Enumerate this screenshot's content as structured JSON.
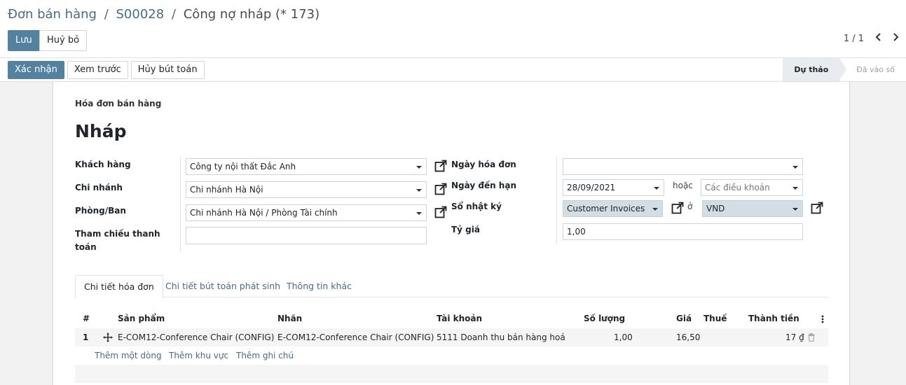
{
  "breadcrumb": {
    "parent": "Đơn bán hàng",
    "sep1": "/",
    "order": "S00028",
    "sep2": "/",
    "current": "Công nợ nháp (* 173)"
  },
  "actions": {
    "save": "Lưu",
    "discard": "Huỷ bỏ"
  },
  "pager": {
    "value": "1 / 1"
  },
  "statusbar": {
    "buttons": [
      "Xác nhận",
      "Xem trước",
      "Hủy bút toán"
    ],
    "stages": [
      {
        "label": "Dự thảo",
        "active": true
      },
      {
        "label": "Đã vào số",
        "active": false
      }
    ]
  },
  "form": {
    "doc_type": "Hóa đơn bán hàng",
    "title": "Nháp",
    "left": {
      "customer_label": "Khách hàng",
      "customer_value": "Công ty nội thất Đắc Anh",
      "branch_label": "Chi nhánh",
      "branch_value": "Chi nhánh Hà Nội",
      "dept_label": "Phòng/Ban",
      "dept_value": "Chi nhánh Hà Nội / Phòng Tài chính",
      "ref_label_1": "Tham chiếu thanh",
      "ref_label_2": "toán",
      "ref_value": ""
    },
    "right": {
      "invoice_date_label": "Ngày hóa đơn",
      "invoice_date_value": "",
      "due_date_label": "Ngày đến hạn",
      "due_date_value": "28/09/2021",
      "or_label": "hoặc",
      "terms_placeholder": "Các điều khoản",
      "journal_label": "Sổ nhật ký",
      "journal_value": "Customer Invoices",
      "in_label": "ở",
      "currency_value": "VND",
      "rate_label": "Tỷ giá",
      "rate_value": "1,00"
    }
  },
  "tabs": [
    "Chi tiết hóa đơn",
    "Chi tiết bút toán phát sinh",
    "Thông tin khác"
  ],
  "table": {
    "headers": {
      "num": "#",
      "product": "Sản phẩm",
      "label": "Nhãn",
      "account": "Tài khoản",
      "qty": "Số lượng",
      "price": "Giá",
      "tax": "Thuế",
      "subtotal": "Thành tiền"
    },
    "rows": [
      {
        "num": "1",
        "product": "E-COM12-Conference Chair (CONFIG)",
        "label": "E-COM12-Conference Chair (CONFIG)",
        "account": "5111 Doanh thu bán hàng hoá",
        "qty": "1,00",
        "price": "16,50",
        "tax": "",
        "subtotal": "17 ₫"
      }
    ],
    "add_links": [
      "Thêm một dòng",
      "Thêm khu vực",
      "Thêm ghi chú"
    ]
  },
  "colors": {
    "primary": "#52829f",
    "link": "#4a6b82"
  }
}
